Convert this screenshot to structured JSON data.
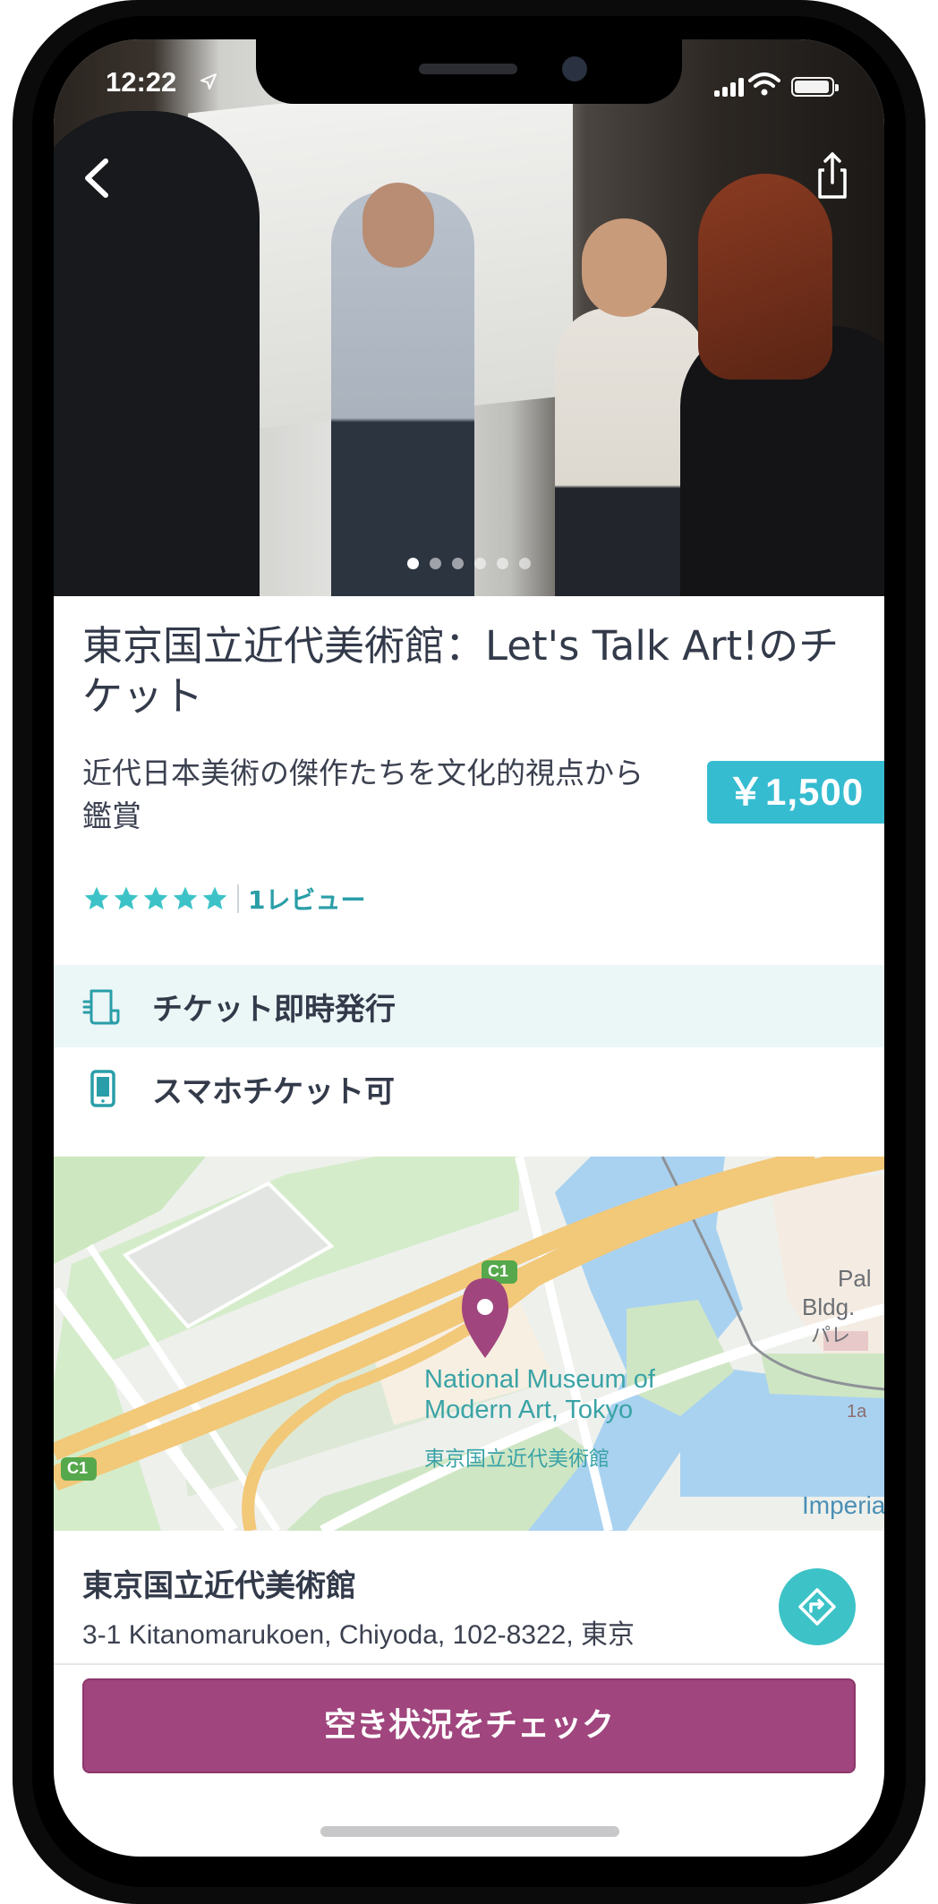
{
  "status_bar": {
    "time": "12:22",
    "icons": [
      "location-arrow-icon",
      "signal-icon",
      "wifi-icon",
      "battery-icon"
    ]
  },
  "header": {
    "back_icon": "chevron-left-icon",
    "share_icon": "share-icon",
    "gallery_dots_count": 6,
    "gallery_active_index": 0
  },
  "product": {
    "title": "東京国立近代美術館：Let's Talk Art!のチケット",
    "subtitle": "近代日本美術の傑作たちを文化的視点から鑑賞",
    "price": "￥1,500",
    "rating_stars": 5,
    "review_label": "1レビュー"
  },
  "features": [
    {
      "icon": "ticket-icon",
      "label": "チケット即時発行"
    },
    {
      "icon": "mobile-phone-icon",
      "label": "スマホチケット可"
    }
  ],
  "map": {
    "place_name_en": "National Museum of Modern Art, Tokyo",
    "place_name_en_line1": "National Museum of",
    "place_name_en_line2": "Modern Art, Tokyo",
    "place_name_jp": "東京国立近代美術館",
    "label_pal": "Pal",
    "label_bldg": "Bldg.",
    "label_pare": "パレ",
    "label_imperial": "Imperia",
    "label_1a": "1a",
    "road_badge": "C1"
  },
  "address": {
    "name": "東京国立近代美術館",
    "line": "3-1 Kitanomarukoen, Chiyoda, 102-8322, 東京"
  },
  "cta": {
    "label": "空き状況をチェック"
  },
  "colors": {
    "accent_teal": "#36bcd1",
    "cta_purple": "#a0457d",
    "feature_bg": "#ebf6f7",
    "text_dark": "#333a4a",
    "star": "#3dc3c7"
  }
}
